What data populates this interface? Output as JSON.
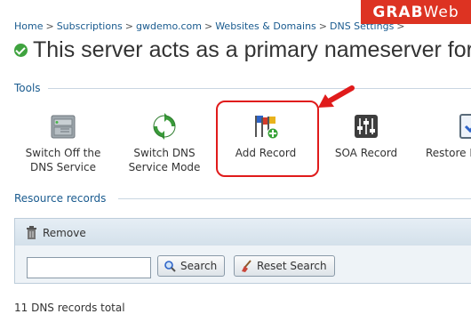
{
  "breadcrumb": [
    "Home",
    "Subscriptions",
    "gwdemo.com",
    "Websites & Domains",
    "DNS Settings"
  ],
  "breadcrumb_sep": ">",
  "watermark": {
    "grab": "GRAB",
    "web": "Web"
  },
  "page_title": "This server acts as a primary nameserver for t",
  "tools": {
    "heading": "Tools",
    "items": [
      {
        "line1": "Switch Off the",
        "line2": "DNS Service",
        "icon": "server-icon"
      },
      {
        "line1": "Switch DNS",
        "line2": "Service Mode",
        "icon": "refresh-icon"
      },
      {
        "line1": "Add Record",
        "line2": "",
        "icon": "add-record-icon"
      },
      {
        "line1": "SOA Record",
        "line2": "",
        "icon": "sliders-icon"
      },
      {
        "line1": "Restore D",
        "line2": "",
        "icon": "restore-icon"
      }
    ]
  },
  "resource_records": {
    "heading": "Resource records",
    "remove_label": "Remove",
    "search_value": "",
    "search_label": "Search",
    "reset_label": "Reset Search",
    "total": "11 DNS records total"
  },
  "colors": {
    "highlight": "#e01b1b",
    "link": "#1a5b8f"
  }
}
